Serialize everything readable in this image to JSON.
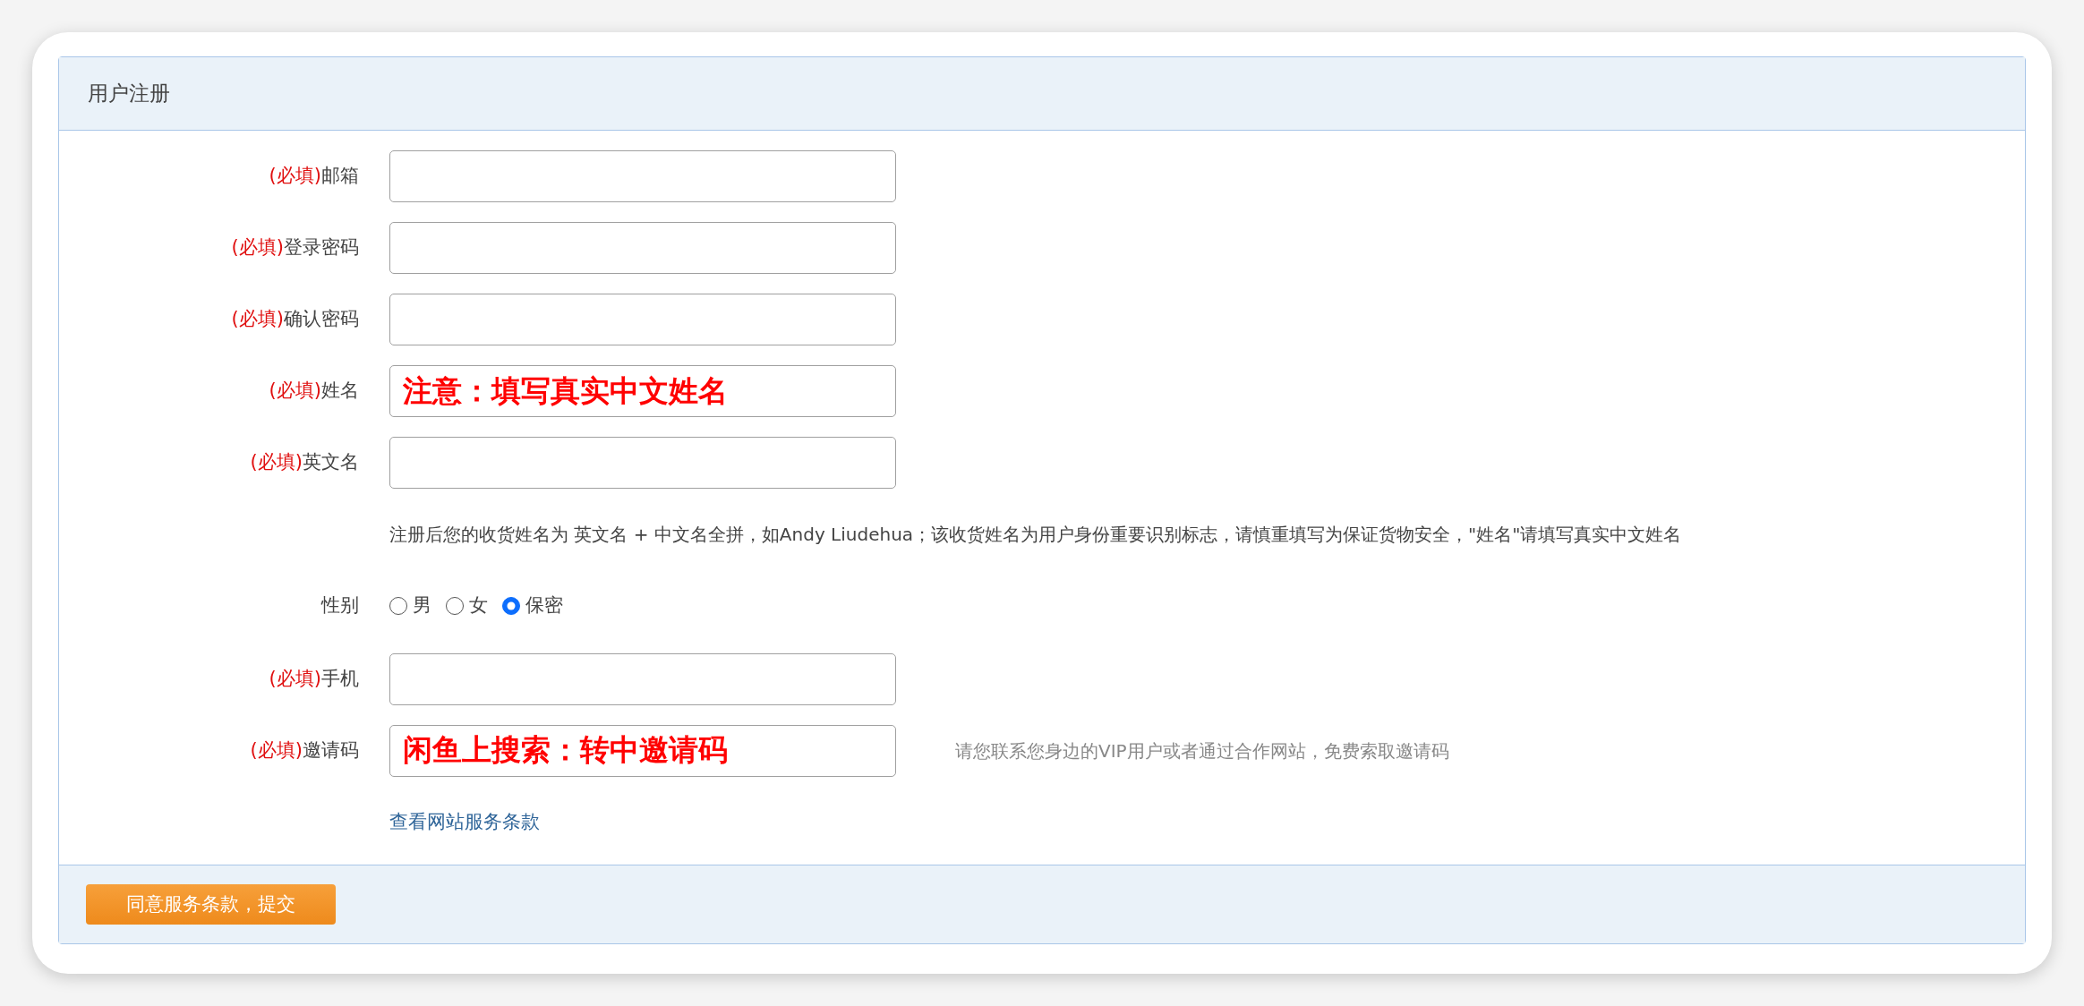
{
  "panel": {
    "title": "用户注册"
  },
  "rows": [
    {
      "kind": "input",
      "required_mark": "(必填)",
      "label": "邮箱"
    },
    {
      "kind": "input",
      "required_mark": "(必填)",
      "label": "登录密码"
    },
    {
      "kind": "input",
      "required_mark": "(必填)",
      "label": "确认密码"
    },
    {
      "kind": "input",
      "required_mark": "(必填)",
      "label": "姓名",
      "value": "注意：填写真实中文姓名"
    },
    {
      "kind": "input",
      "required_mark": "(必填)",
      "label": "英文名"
    },
    {
      "kind": "note",
      "text": "注册后您的收货姓名为 英文名 + 中文名全拼，如Andy Liudehua；该收货姓名为用户身份重要识别标志，请慎重填写为保证货物安全，\"姓名\"请填写真实中文姓名"
    },
    {
      "kind": "radio",
      "label": "性别",
      "options": [
        {
          "label": "男",
          "selected": false
        },
        {
          "label": "女",
          "selected": false
        },
        {
          "label": "保密",
          "selected": true
        }
      ]
    },
    {
      "kind": "input",
      "required_mark": "(必填)",
      "label": "手机"
    },
    {
      "kind": "input",
      "required_mark": "(必填)",
      "label": "邀请码",
      "value": "闲鱼上搜索：转中邀请码",
      "hint": "请您联系您身边的VIP用户或者通过合作网站，免费索取邀请码"
    },
    {
      "kind": "link",
      "text": "查看网站服务条款"
    }
  ],
  "submit_button": "同意服务条款，提交"
}
